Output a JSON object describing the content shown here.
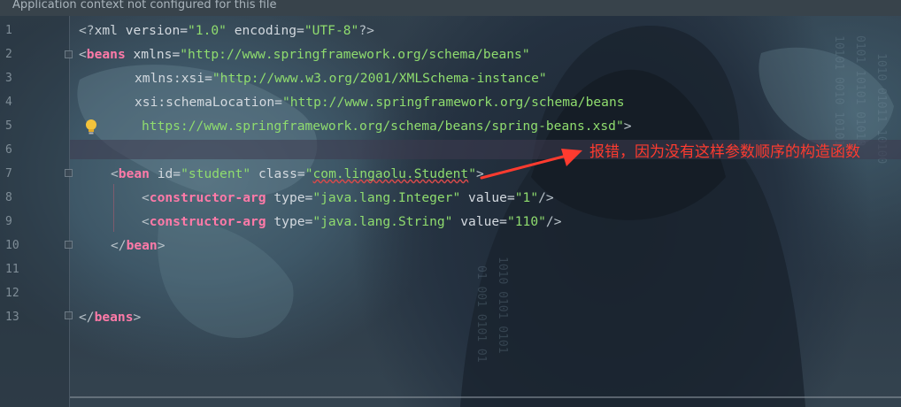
{
  "notice_bar": {
    "text": "Application context not configured for this file"
  },
  "gutter": {
    "line_numbers": [
      "1",
      "2",
      "3",
      "4",
      "5",
      "6",
      "7",
      "8",
      "9",
      "10",
      "11",
      "12",
      "13"
    ]
  },
  "code": {
    "line1": {
      "open": "<?",
      "name": "xml",
      "attr1": " version=",
      "val1": "\"1.0\"",
      "attr2": " encoding=",
      "val2": "\"UTF-8\"",
      "close": "?>"
    },
    "line2": {
      "open": "<",
      "tag": "beans",
      "attr": " xmlns=",
      "val": "\"http://www.springframework.org/schema/beans\""
    },
    "line3": {
      "attr": "xmlns:xsi=",
      "val": "\"http://www.w3.org/2001/XMLSchema-instance\""
    },
    "line4": {
      "attr": "xsi:schemaLocation=",
      "val": "\"http://www.springframework.org/schema/beans"
    },
    "line5": {
      "val": "https://www.springframework.org/schema/beans/spring-beans.xsd\"",
      "close": ">"
    },
    "line7": {
      "open": "<",
      "tag": "bean",
      "attr1": " id=",
      "val1": "\"student\"",
      "attr2": " class=",
      "val2_q1": "\"",
      "val2_text": "com.lingaolu.Student",
      "val2_q2": "\"",
      "close": ">"
    },
    "line8": {
      "open": "<",
      "tag": "constructor-arg",
      "attr1": " type=",
      "val1": "\"java.lang.Integer\"",
      "attr2": " value=",
      "val2": "\"1\"",
      "close": "/>"
    },
    "line9": {
      "open": "<",
      "tag": "constructor-arg",
      "attr1": " type=",
      "val1": "\"java.lang.String\"",
      "attr2": " value=",
      "val2": "\"110\"",
      "close": "/>"
    },
    "line10": {
      "open": "</",
      "tag": "bean",
      "close": ">"
    },
    "line13": {
      "open": "</",
      "tag": "beans",
      "close": ">"
    }
  },
  "annotation": {
    "text": "报错，因为没有这样参数顺序的构造函数",
    "color": "#ff3b2f"
  },
  "icons": {
    "bulb": "lightbulb-icon"
  },
  "colors": {
    "tag": "#ff7aa8",
    "value": "#8fdc6e",
    "attribute": "#d3d9df",
    "error": "#ff3b2f"
  }
}
